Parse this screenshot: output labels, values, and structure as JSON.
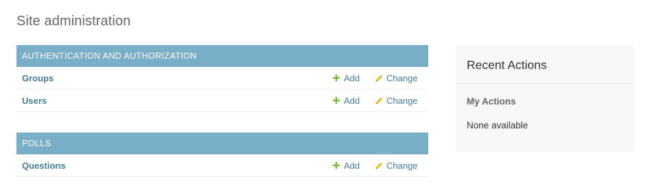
{
  "page": {
    "title": "Site administration"
  },
  "modules": [
    {
      "caption": "AUTHENTICATION AND AUTHORIZATION",
      "models": [
        {
          "name": "Groups",
          "add_label": "Add",
          "change_label": "Change"
        },
        {
          "name": "Users",
          "add_label": "Add",
          "change_label": "Change"
        }
      ]
    },
    {
      "caption": "POLLS",
      "models": [
        {
          "name": "Questions",
          "add_label": "Add",
          "change_label": "Change"
        }
      ]
    }
  ],
  "recent_actions": {
    "title": "Recent Actions",
    "my_actions_label": "My Actions",
    "empty_text": "None available"
  },
  "icons": {
    "add": "plus-icon",
    "change": "pencil-icon"
  },
  "colors": {
    "caption_bg": "#79aec8",
    "link": "#447e9b",
    "add_icon": "#70bf2b",
    "change_icon": "#efb80b",
    "sidebar_bg": "#f8f8f8"
  }
}
